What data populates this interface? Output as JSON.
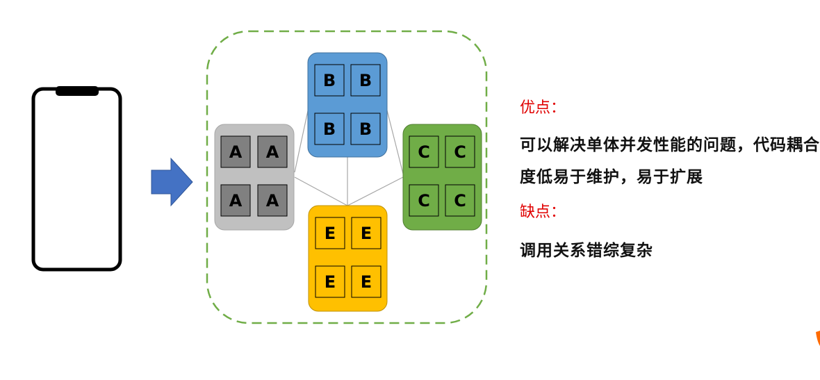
{
  "tiles": {
    "a": "A",
    "b": "B",
    "c": "C",
    "e": "E"
  },
  "colors": {
    "dashed_border": "#70ad47",
    "arrow": "#4472c4",
    "group_a": "#c0c0c0",
    "group_b": "#5b9bd5",
    "group_c": "#70ad47",
    "group_e": "#ffc000",
    "tile_a": "#808080",
    "heading": "#e00000"
  },
  "icons": [
    "phone-icon",
    "right-arrow-icon"
  ],
  "text_panel": {
    "pros_heading": "优点：",
    "pros_text": "可以解决单体并发性能的问题，代码耦合度低易于维护，易于扩展",
    "cons_heading": "缺点：",
    "cons_text": "调用关系错综复杂"
  }
}
